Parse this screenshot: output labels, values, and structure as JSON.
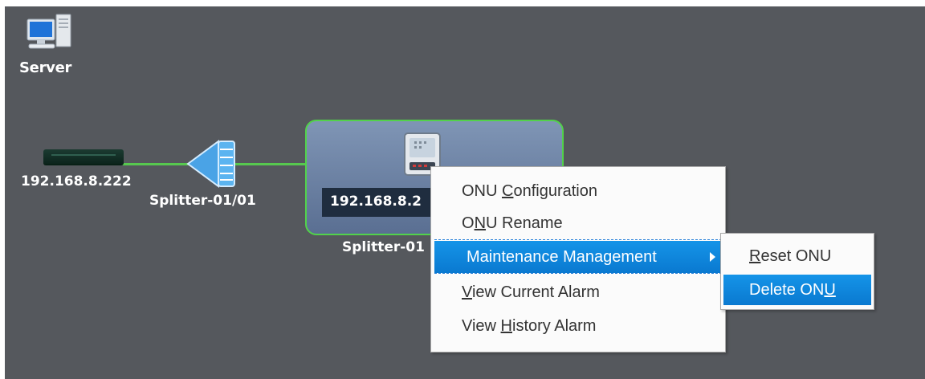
{
  "topology": {
    "server": {
      "label": "Server",
      "icon": "server-icon"
    },
    "olt": {
      "ip": "192.168.8.222",
      "icon": "olt-device-icon"
    },
    "splitter": {
      "label": "Splitter-01/01",
      "icon": "splitter-icon"
    },
    "onu": {
      "ip": "192.168.8.2",
      "group_label": "Splitter-01",
      "icon": "onu-device-icon"
    },
    "link_color": "#57c84f",
    "canvas_bg": "#55585d"
  },
  "context_menu": {
    "items": [
      {
        "pre": "ONU ",
        "key": "C",
        "post": "onfiguration"
      },
      {
        "pre": "O",
        "key": "N",
        "post": "U Rename"
      },
      {
        "pre": "",
        "key": "",
        "post": "Maintenance Management"
      },
      {
        "pre": "",
        "key": "V",
        "post": "iew Current Alarm"
      },
      {
        "pre": "View ",
        "key": "H",
        "post": "istory Alarm"
      }
    ]
  },
  "submenu": {
    "items": [
      {
        "pre": "",
        "key": "R",
        "post": "eset ONU"
      },
      {
        "pre": "Delete ON",
        "key": "U",
        "post": ""
      }
    ]
  },
  "colors": {
    "highlight": "#0a79d0"
  }
}
